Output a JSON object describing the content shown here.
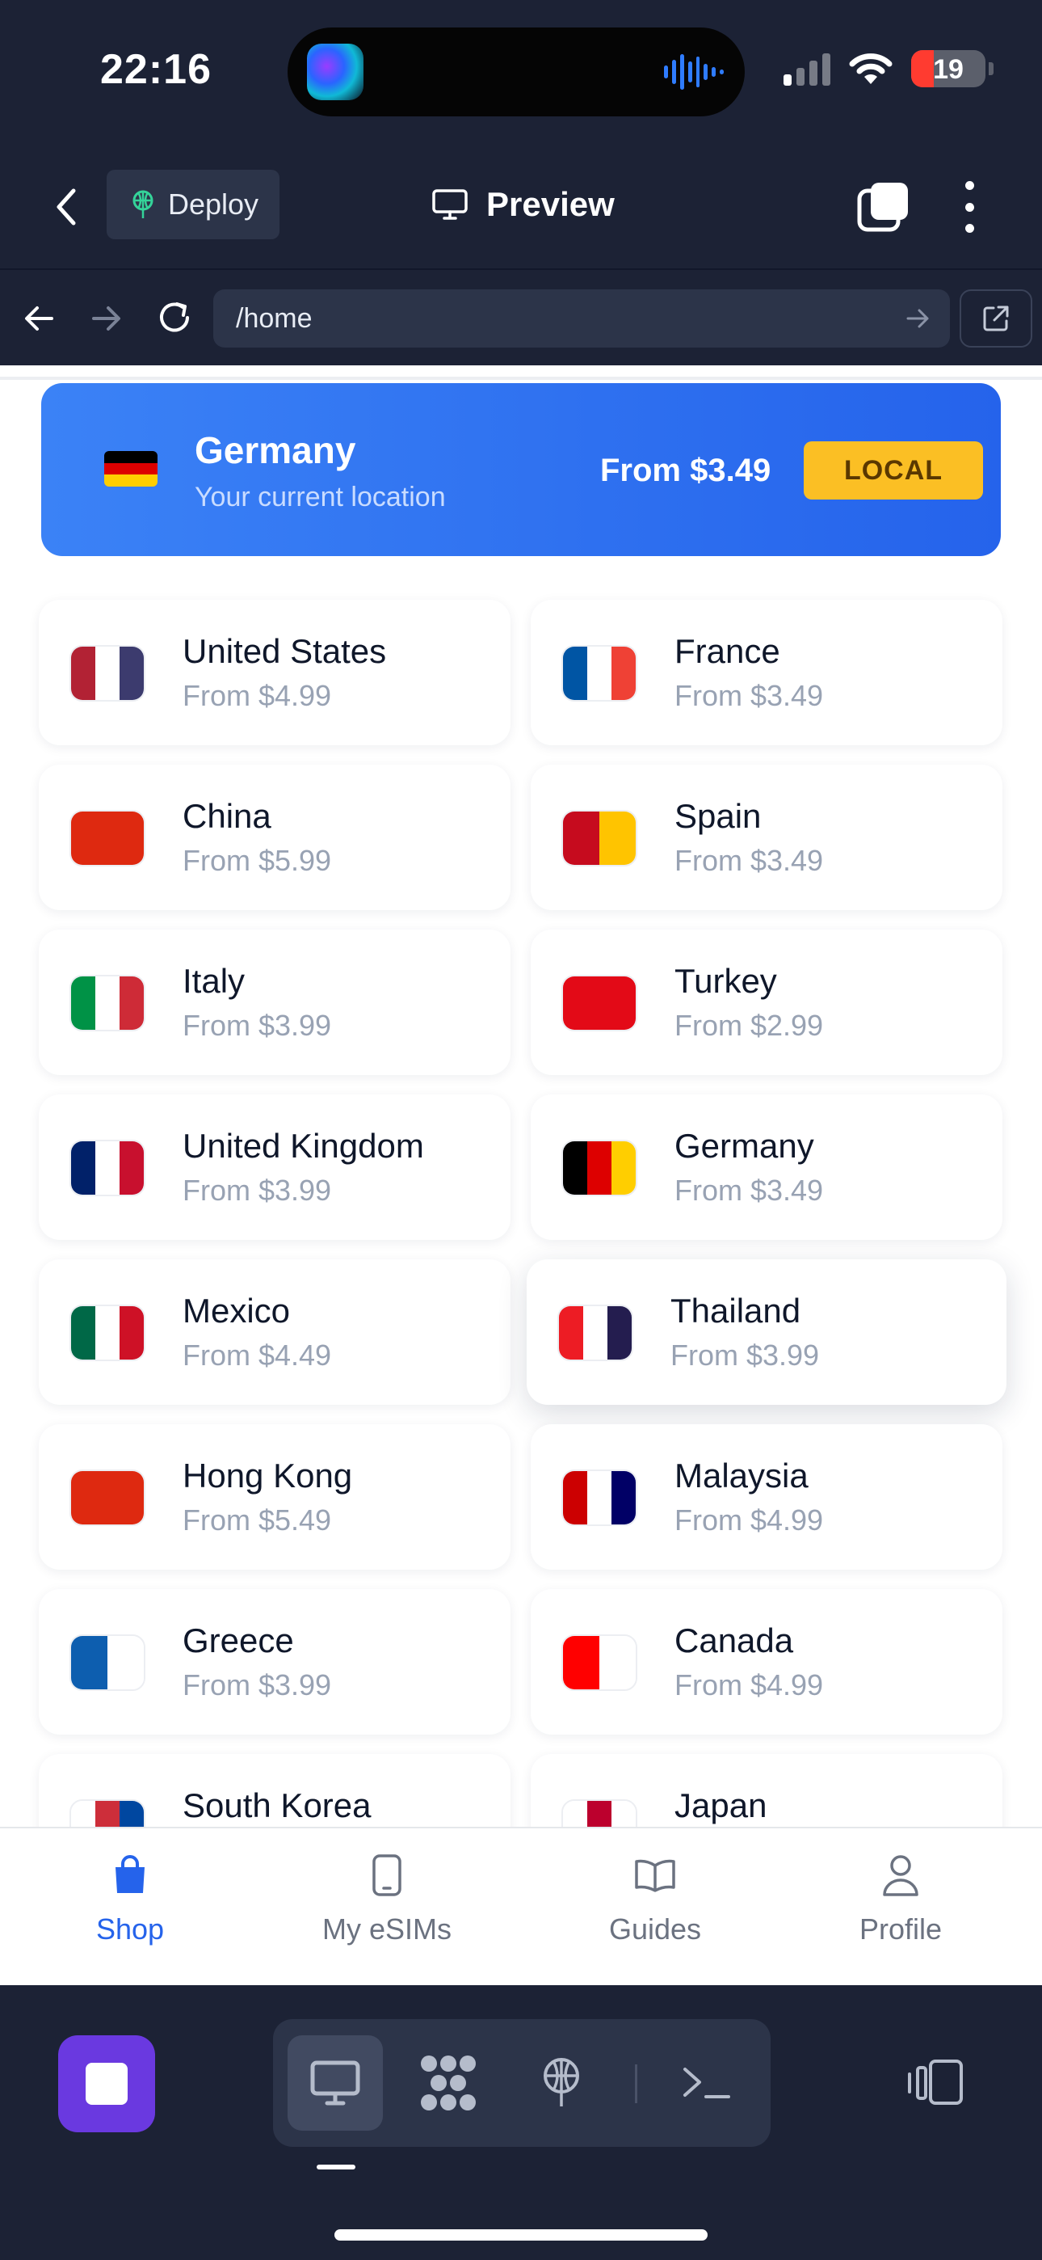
{
  "status_bar": {
    "time": "22:16",
    "battery": "19",
    "battery_level_percent": 19,
    "signal_bars_active": 1,
    "colors": {
      "battery_low": "#ff3b30",
      "island_wave": "#2f7cff"
    }
  },
  "toolbar": {
    "deploy_label": "Deploy",
    "preview_label": "Preview"
  },
  "browser": {
    "url": "/home"
  },
  "hero": {
    "country": "Germany",
    "subtitle": "Your current location",
    "price": "From $3.49",
    "badge": "LOCAL",
    "flag_colors": [
      "#000000",
      "#dd0000",
      "#ffce00"
    ],
    "colors": {
      "gradient_start": "#3b82f6",
      "gradient_end": "#2563eb",
      "badge": "#fbbf24"
    }
  },
  "countries": [
    {
      "name": "United States",
      "price": "From $4.99",
      "flag": [
        "#b22234",
        "#ffffff",
        "#3c3b6e"
      ]
    },
    {
      "name": "France",
      "price": "From $3.49",
      "flag": [
        "#0055a4",
        "#ffffff",
        "#ef4135"
      ]
    },
    {
      "name": "China",
      "price": "From $5.99",
      "flag": [
        "#de2910"
      ]
    },
    {
      "name": "Spain",
      "price": "From $3.49",
      "flag": [
        "#c60b1e",
        "#ffc400"
      ]
    },
    {
      "name": "Italy",
      "price": "From $3.99",
      "flag": [
        "#009246",
        "#ffffff",
        "#ce2b37"
      ]
    },
    {
      "name": "Turkey",
      "price": "From $2.99",
      "flag": [
        "#e30a17"
      ]
    },
    {
      "name": "United Kingdom",
      "price": "From $3.99",
      "flag": [
        "#012169",
        "#ffffff",
        "#c8102e"
      ]
    },
    {
      "name": "Germany",
      "price": "From $3.49",
      "flag": [
        "#000000",
        "#dd0000",
        "#ffce00"
      ]
    },
    {
      "name": "Mexico",
      "price": "From $4.49",
      "flag": [
        "#006847",
        "#ffffff",
        "#ce1126"
      ]
    },
    {
      "name": "Thailand",
      "price": "From $3.99",
      "flag": [
        "#ed1c24",
        "#ffffff",
        "#241d4f"
      ]
    },
    {
      "name": "Hong Kong",
      "price": "From $5.49",
      "flag": [
        "#de2910"
      ]
    },
    {
      "name": "Malaysia",
      "price": "From $4.99",
      "flag": [
        "#cc0001",
        "#ffffff",
        "#010066"
      ]
    },
    {
      "name": "Greece",
      "price": "From $3.99",
      "flag": [
        "#0d5eaf",
        "#ffffff"
      ]
    },
    {
      "name": "Canada",
      "price": "From $4.99",
      "flag": [
        "#ff0000",
        "#ffffff"
      ]
    },
    {
      "name": "South Korea",
      "price": "",
      "flag": [
        "#ffffff",
        "#cd2e3a",
        "#0047a0"
      ]
    },
    {
      "name": "Japan",
      "price": "",
      "flag": [
        "#ffffff",
        "#bc002d",
        "#ffffff"
      ]
    }
  ],
  "tabs": [
    {
      "label": "Shop",
      "icon": "shopping-bag-icon",
      "active": true
    },
    {
      "label": "My eSIMs",
      "icon": "phone-icon",
      "active": false
    },
    {
      "label": "Guides",
      "icon": "book-icon",
      "active": false
    },
    {
      "label": "Profile",
      "icon": "user-icon",
      "active": false
    }
  ],
  "ide": {
    "colors": {
      "stop": "#6a39e0",
      "accent": "#2563eb"
    }
  }
}
